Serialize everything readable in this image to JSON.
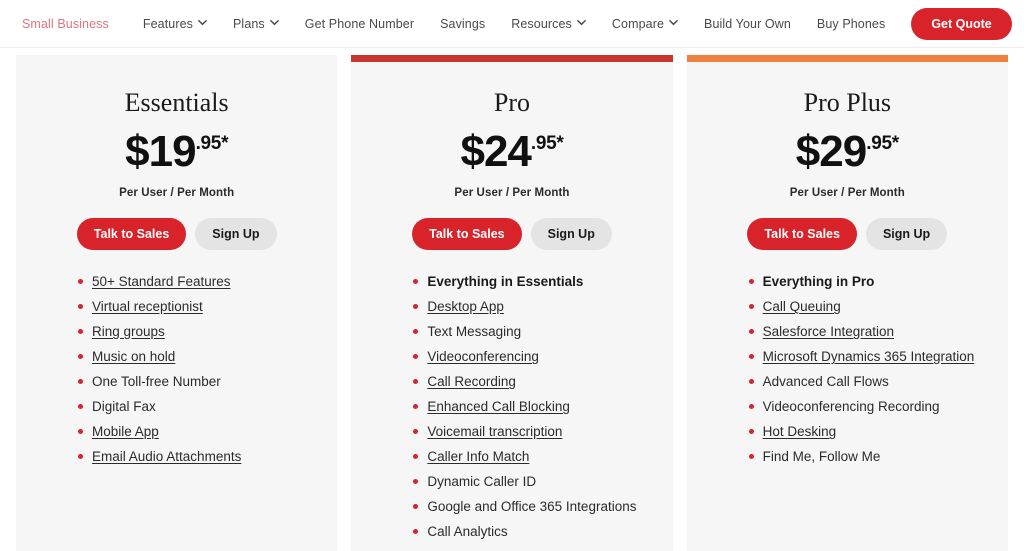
{
  "nav": {
    "brand": "Small Business",
    "items": [
      {
        "label": "Features",
        "caret": true,
        "icon": "chevron-down-icon"
      },
      {
        "label": "Plans",
        "caret": true,
        "icon": "chevron-down-icon"
      },
      {
        "label": "Get Phone Number",
        "caret": false
      },
      {
        "label": "Savings",
        "caret": false
      },
      {
        "label": "Resources",
        "caret": true,
        "icon": "chevron-down-icon"
      },
      {
        "label": "Compare",
        "caret": true,
        "icon": "chevron-down-icon"
      },
      {
        "label": "Build Your Own",
        "caret": false
      },
      {
        "label": "Buy Phones",
        "caret": false
      }
    ],
    "cta_label": "Get Quote",
    "brand_color": "#e2757a",
    "cta_color": "#d8232a"
  },
  "plans": [
    {
      "name": "Essentials",
      "price_whole": "$19",
      "price_cents": ".95*",
      "per": "Per User / Per Month",
      "primary_label": "Talk to Sales",
      "secondary_label": "Sign Up",
      "accent": "none",
      "features": [
        {
          "label": "50+ Standard Features",
          "link": true,
          "bold": false
        },
        {
          "label": "Virtual receptionist",
          "link": true,
          "bold": false
        },
        {
          "label": "Ring groups",
          "link": true,
          "bold": false
        },
        {
          "label": "Music on hold",
          "link": true,
          "bold": false
        },
        {
          "label": "One Toll-free Number",
          "link": false,
          "bold": false
        },
        {
          "label": "Digital Fax",
          "link": false,
          "bold": false
        },
        {
          "label": "Mobile App",
          "link": true,
          "bold": false
        },
        {
          "label": "Email Audio Attachments",
          "link": true,
          "bold": false
        }
      ]
    },
    {
      "name": "Pro",
      "price_whole": "$24",
      "price_cents": ".95*",
      "per": "Per User / Per Month",
      "primary_label": "Talk to Sales",
      "secondary_label": "Sign Up",
      "accent": "#c8342f",
      "features": [
        {
          "label": "Everything in Essentials",
          "link": false,
          "bold": true
        },
        {
          "label": "Desktop App",
          "link": true,
          "bold": false
        },
        {
          "label": "Text Messaging",
          "link": false,
          "bold": false
        },
        {
          "label": "Videoconferencing",
          "link": true,
          "bold": false
        },
        {
          "label": "Call Recording",
          "link": true,
          "bold": false
        },
        {
          "label": "Enhanced Call Blocking",
          "link": true,
          "bold": false
        },
        {
          "label": "Voicemail transcription",
          "link": true,
          "bold": false
        },
        {
          "label": "Caller Info Match",
          "link": true,
          "bold": false
        },
        {
          "label": "Dynamic Caller ID",
          "link": false,
          "bold": false
        },
        {
          "label": "Google and Office 365 Integrations",
          "link": false,
          "bold": false
        },
        {
          "label": "Call Analytics",
          "link": false,
          "bold": false
        }
      ]
    },
    {
      "name": "Pro Plus",
      "price_whole": "$29",
      "price_cents": ".95*",
      "per": "Per User / Per Month",
      "primary_label": "Talk to Sales",
      "secondary_label": "Sign Up",
      "accent": "#f08040",
      "features": [
        {
          "label": "Everything in Pro",
          "link": false,
          "bold": true
        },
        {
          "label": "Call Queuing",
          "link": true,
          "bold": false
        },
        {
          "label": "Salesforce Integration",
          "link": true,
          "bold": false
        },
        {
          "label": "Microsoft Dynamics 365 Integration",
          "link": true,
          "bold": false
        },
        {
          "label": "Advanced Call Flows",
          "link": false,
          "bold": false
        },
        {
          "label": "Videoconferencing Recording",
          "link": false,
          "bold": false
        },
        {
          "label": "Hot Desking",
          "link": true,
          "bold": false
        },
        {
          "label": "Find Me, Follow Me",
          "link": false,
          "bold": false
        }
      ]
    }
  ],
  "theme": {
    "bullet_color": "#d8232a",
    "card_bg": "#f6f6f6",
    "page_bg": "#ffffff"
  }
}
